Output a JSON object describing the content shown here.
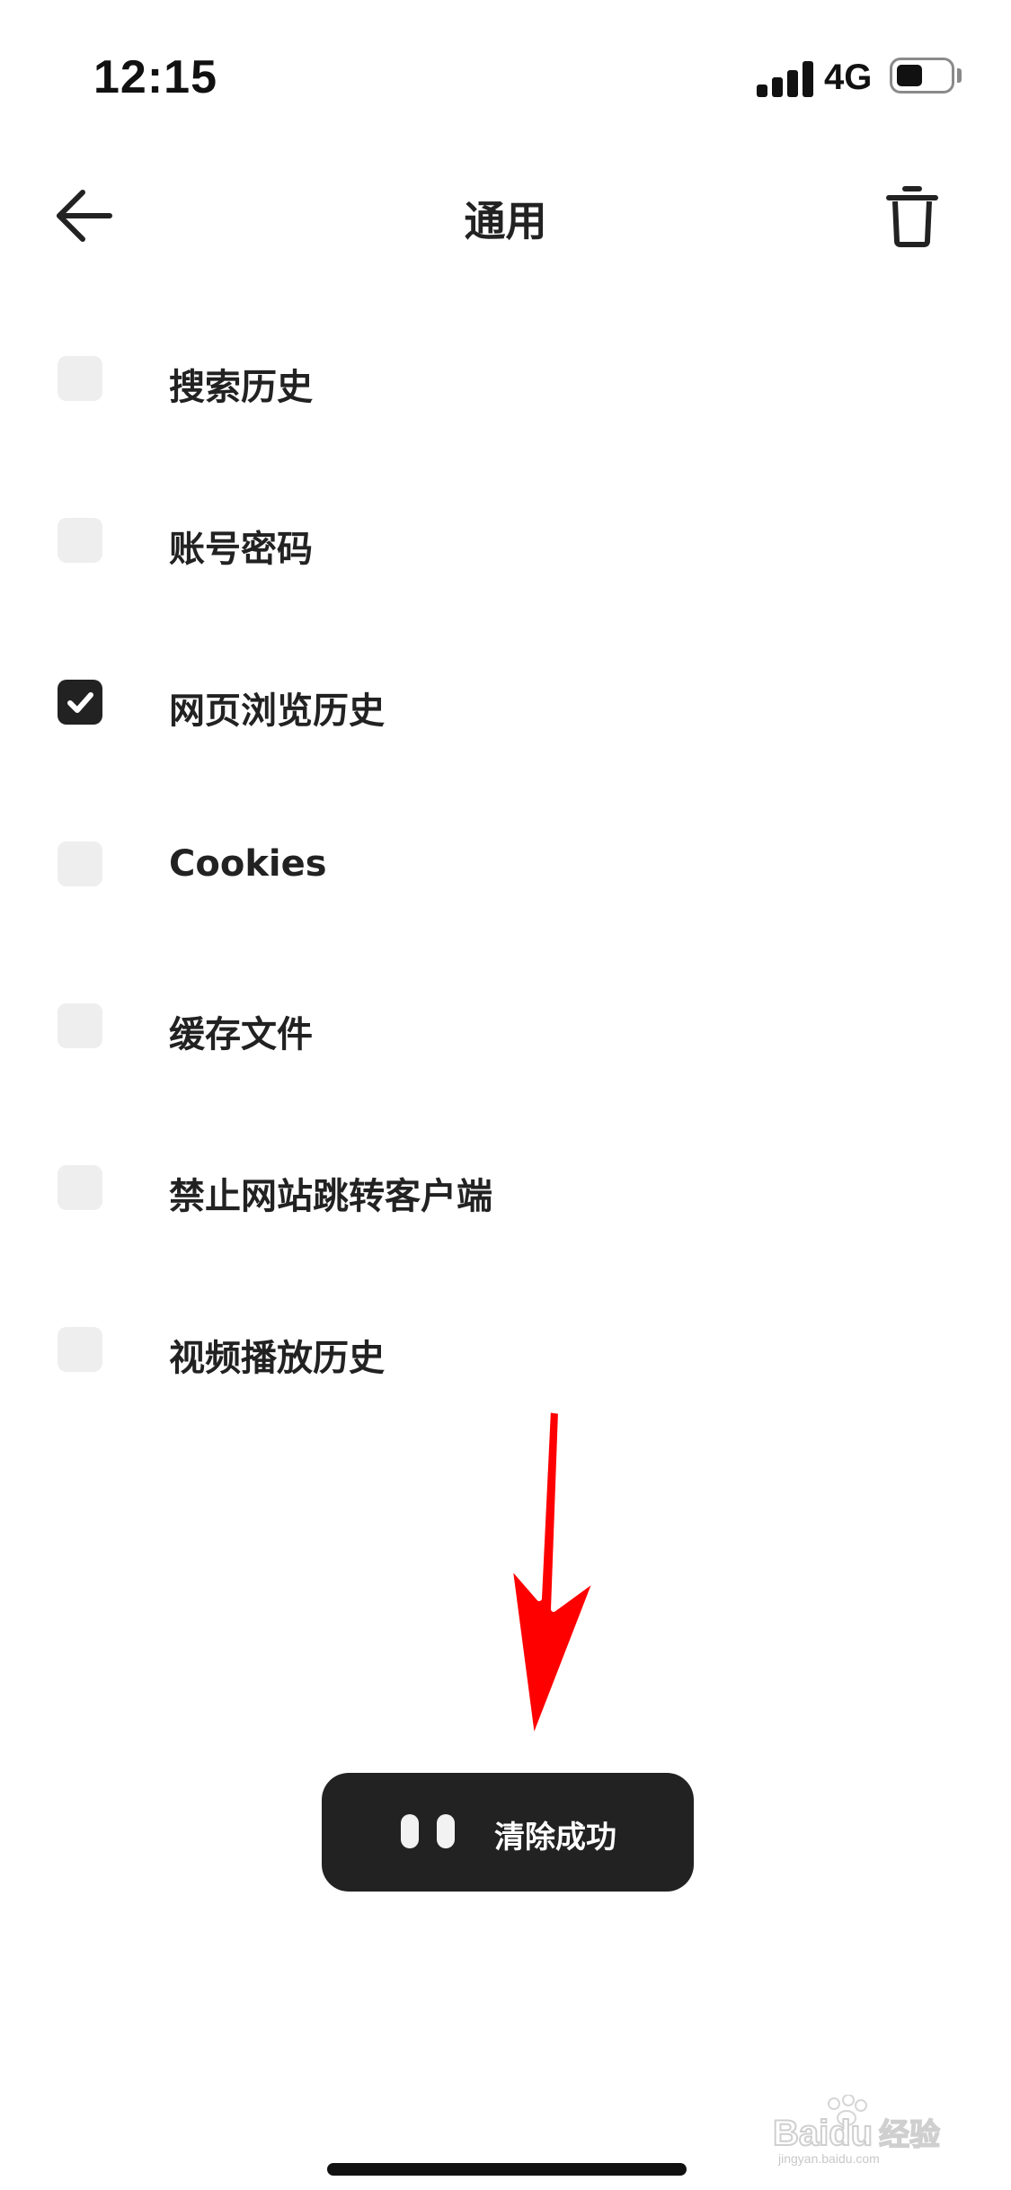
{
  "status_bar": {
    "time": "12:15",
    "network": "4G",
    "battery_level": 0.45,
    "signal_bars": 4
  },
  "header": {
    "title": "通用",
    "back_icon": "arrow-left-icon",
    "delete_icon": "trash-icon"
  },
  "options": [
    {
      "label": "搜索历史",
      "checked": false
    },
    {
      "label": "账号密码",
      "checked": false
    },
    {
      "label": "网页浏览历史",
      "checked": true
    },
    {
      "label": "Cookies",
      "checked": false
    },
    {
      "label": "缓存文件",
      "checked": false
    },
    {
      "label": "禁止网站跳转客户端",
      "checked": false
    },
    {
      "label": "视频播放历史",
      "checked": false
    }
  ],
  "toast": {
    "text": "清除成功"
  },
  "annotation": {
    "color": "#ff0000"
  },
  "watermark": {
    "text": "Baidu经验",
    "subtext": "jingyan.baidu.com"
  },
  "colors": {
    "checkbox_unchecked": "#eeeeee",
    "checkbox_checked": "#222222",
    "toast_background": "#222222"
  }
}
